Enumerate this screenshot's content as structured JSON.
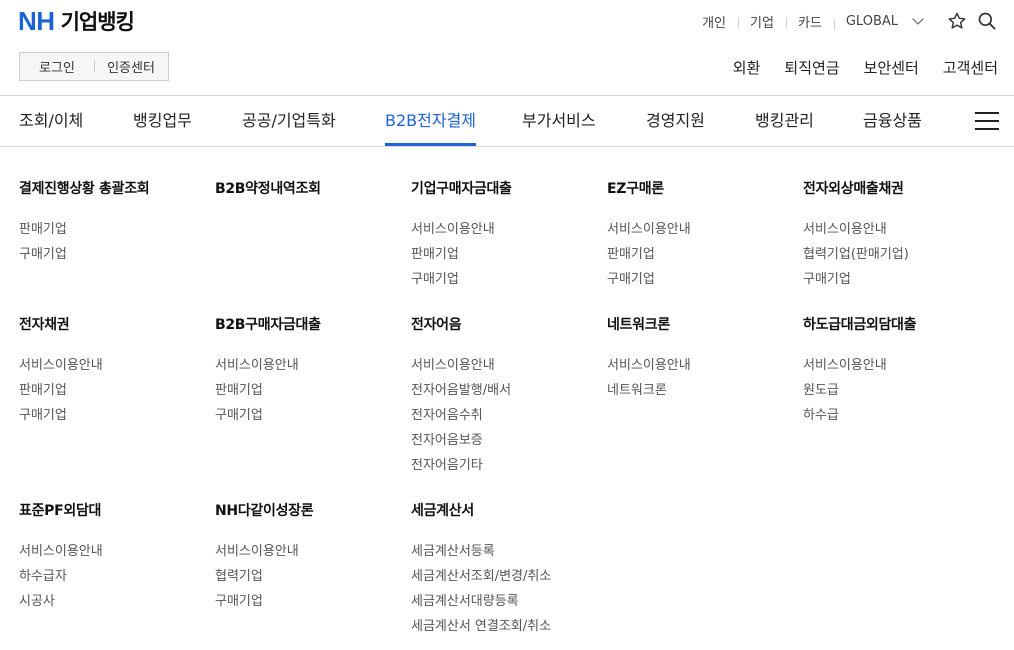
{
  "logo": {
    "brand": "NH",
    "name": "기업뱅킹"
  },
  "top_links": [
    "개인",
    "기업",
    "카드",
    "GLOBAL"
  ],
  "login": {
    "login": "로그인",
    "cert": "인증센터"
  },
  "sub_links": [
    "외환",
    "퇴직연금",
    "보안센터",
    "고객센터"
  ],
  "gnb": [
    "조회/이체",
    "뱅킹업무",
    "공공/기업특화",
    "B2B전자결제",
    "부가서비스",
    "경영지원",
    "뱅킹관리",
    "금융상품"
  ],
  "gnb_active": "B2B전자결제",
  "colors": {
    "accent": "#1d63d8"
  },
  "icons": {
    "star": "star-icon",
    "search": "search-icon",
    "menu": "hamburger-menu-icon",
    "dropdown": "chevron-down-icon"
  },
  "groups": [
    {
      "title": "결제진행상황 총괄조회",
      "items": [
        "판매기업",
        "구매기업"
      ]
    },
    {
      "title": "B2B약정내역조회",
      "items": []
    },
    {
      "title": "기업구매자금대출",
      "items": [
        "서비스이용안내",
        "판매기업",
        "구매기업"
      ]
    },
    {
      "title": "EZ구매론",
      "items": [
        "서비스이용안내",
        "판매기업",
        "구매기업"
      ]
    },
    {
      "title": "전자외상매출채권",
      "items": [
        "서비스이용안내",
        "협력기업(판매기업)",
        "구매기업"
      ]
    },
    {
      "title": "전자채권",
      "items": [
        "서비스이용안내",
        "판매기업",
        "구매기업"
      ]
    },
    {
      "title": "B2B구매자금대출",
      "items": [
        "서비스이용안내",
        "판매기업",
        "구매기업"
      ]
    },
    {
      "title": "전자어음",
      "items": [
        "서비스이용안내",
        "전자어음발행/배서",
        "전자어음수취",
        "전자어음보증",
        "전자어음기타"
      ]
    },
    {
      "title": "네트워크론",
      "items": [
        "서비스이용안내",
        "네트워크론"
      ]
    },
    {
      "title": "하도급대금외담대출",
      "items": [
        "서비스이용안내",
        "원도급",
        "하수급"
      ]
    },
    {
      "title": "표준PF외담대",
      "items": [
        "서비스이용안내",
        "하수급자",
        "시공사"
      ]
    },
    {
      "title": "NH다같이성장론",
      "items": [
        "서비스이용안내",
        "협력기업",
        "구매기업"
      ]
    },
    {
      "title": "세금계산서",
      "items": [
        "세금계산서등록",
        "세금계산서조회/변경/취소",
        "세금계산서대량등록",
        "세금계산서 연결조회/취소"
      ]
    }
  ]
}
